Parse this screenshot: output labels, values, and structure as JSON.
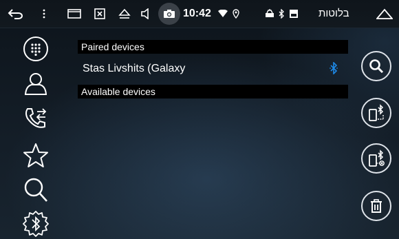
{
  "statusbar": {
    "time": "10:42",
    "title": "בלוטות",
    "icons": [
      "back-icon",
      "more-vert-icon",
      "recent-apps-icon",
      "screenshot-box-icon",
      "eject-icon",
      "volume-icon",
      "camera-icon",
      "wifi-icon",
      "location-icon",
      "car-icon",
      "bluetooth-icon",
      "sd-card-icon",
      "home-icon"
    ]
  },
  "sidebar": {
    "items": [
      {
        "name": "dialpad",
        "icon": "dialpad-icon"
      },
      {
        "name": "contacts",
        "icon": "person-icon"
      },
      {
        "name": "call-log",
        "icon": "call-transfer-icon"
      },
      {
        "name": "favorites",
        "icon": "star-icon"
      },
      {
        "name": "search",
        "icon": "search-icon"
      },
      {
        "name": "bluetooth-settings",
        "icon": "bluetooth-gear-icon"
      }
    ]
  },
  "lists": {
    "paired_header": "Paired devices",
    "paired_devices": [
      {
        "name": "Stas Livshits (Galaxy"
      }
    ],
    "available_header": "Available devices"
  },
  "actions": [
    {
      "name": "search",
      "icon": "search-icon"
    },
    {
      "name": "connect",
      "icon": "phone-bluetooth-connect-icon"
    },
    {
      "name": "disconnect",
      "icon": "phone-bluetooth-disconnect-icon"
    },
    {
      "name": "delete",
      "icon": "trash-icon"
    }
  ],
  "colors": {
    "accent_bluetooth": "#1e88e5",
    "background": "#0b1016",
    "header_bg": "#000000"
  }
}
